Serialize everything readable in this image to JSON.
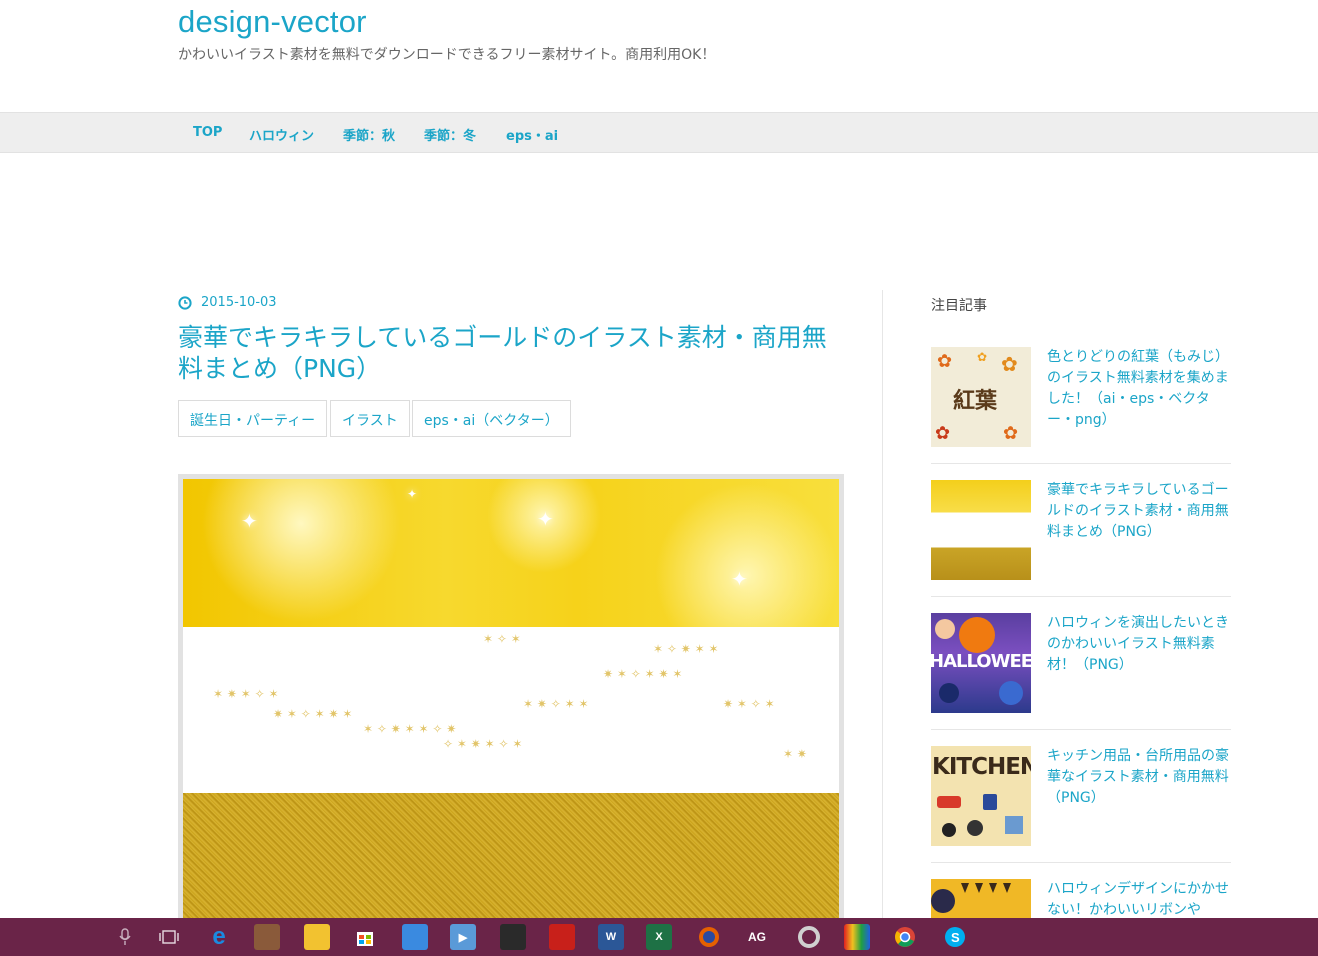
{
  "site": {
    "title": "design-vector",
    "description": "かわいいイラスト素材を無料でダウンロードできるフリー素材サイト。商用利用OK！"
  },
  "nav": {
    "items": [
      "TOP",
      "ハロウィン",
      "季節：秋",
      "季節：冬",
      "eps・ai"
    ]
  },
  "post": {
    "date": "2015-10-03",
    "title": "豪華でキラキラしているゴールドのイラスト素材・商用無料まとめ（PNG）",
    "tags": [
      "誕生日・パーティー",
      "イラスト",
      "eps・ai（ベクター）"
    ]
  },
  "sidebar": {
    "heading": "注目記事",
    "items": [
      {
        "title": "色とりどりの紅葉（もみじ）のイラスト無料素材を集めました！（ai・eps・ベクター・png）",
        "thumb_label": "紅葉"
      },
      {
        "title": "豪華でキラキラしているゴールドのイラスト素材・商用無料まとめ（PNG）",
        "thumb_label": ""
      },
      {
        "title": "ハロウィンを演出したいときのかわいいイラスト無料素材！（PNG）",
        "thumb_label": "HALLOWEEN"
      },
      {
        "title": "キッチン用品・台所用品の豪華なイラスト素材・商用無料（PNG）",
        "thumb_label": "KITCHEN"
      },
      {
        "title": "ハロウィンデザインにかかせない！かわいいリボンや",
        "thumb_label": ""
      }
    ]
  },
  "taskbar": {
    "icons": [
      "microphone-icon",
      "task-view-icon",
      "edge-icon",
      "app-icon",
      "file-explorer-icon",
      "store-icon",
      "contacts-icon",
      "media-player-icon",
      "app-icon",
      "acrobat-icon",
      "word-icon",
      "excel-icon",
      "firefox-icon",
      "ag-icon",
      "app-icon",
      "app-icon",
      "chrome-icon",
      "skype-icon"
    ],
    "labels": {
      "word": "W",
      "excel": "X",
      "ag": "AG"
    }
  },
  "colors": {
    "accent": "#1ba5c8",
    "nav_bg": "#eeeeee",
    "taskbar": "#6a2448"
  }
}
